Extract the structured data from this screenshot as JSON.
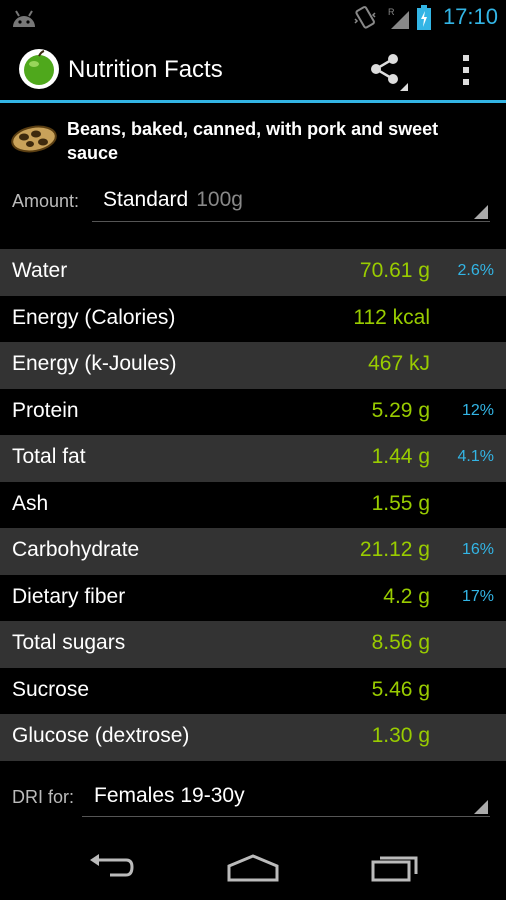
{
  "status_bar": {
    "time": "17:10"
  },
  "action_bar": {
    "title": "Nutrition Facts"
  },
  "food": {
    "name": "Beans, baked, canned, with pork and sweet sauce"
  },
  "amount": {
    "label": "Amount:",
    "value": "Standard",
    "unit": "100g"
  },
  "nutrients": [
    {
      "name": "Water",
      "value": "70.61 g",
      "pct": "2.6%"
    },
    {
      "name": "Energy (Calories)",
      "value": "112 kcal",
      "pct": ""
    },
    {
      "name": "Energy (k-Joules)",
      "value": "467 kJ",
      "pct": ""
    },
    {
      "name": "Protein",
      "value": "5.29 g",
      "pct": "12%"
    },
    {
      "name": "Total fat",
      "value": "1.44 g",
      "pct": "4.1%"
    },
    {
      "name": "Ash",
      "value": "1.55 g",
      "pct": ""
    },
    {
      "name": "Carbohydrate",
      "value": "21.12 g",
      "pct": "16%"
    },
    {
      "name": "Dietary fiber",
      "value": "4.2 g",
      "pct": "17%"
    },
    {
      "name": "Total sugars",
      "value": "8.56 g",
      "pct": ""
    },
    {
      "name": "Sucrose",
      "value": "5.46 g",
      "pct": ""
    },
    {
      "name": "Glucose (dextrose)",
      "value": "1.30 g",
      "pct": ""
    }
  ],
  "dri": {
    "label": "DRI for:",
    "value": "Females 19-30y"
  },
  "icons": [
    "android-icon",
    "vibrate-icon",
    "signal-icon",
    "battery-icon",
    "apple-logo-icon",
    "share-icon",
    "overflow-menu-icon",
    "beans-icon",
    "back-icon",
    "home-icon",
    "recent-apps-icon"
  ],
  "colors": {
    "accent": "#33b5e5",
    "value": "#99cc00",
    "row_alt": "#333333"
  }
}
